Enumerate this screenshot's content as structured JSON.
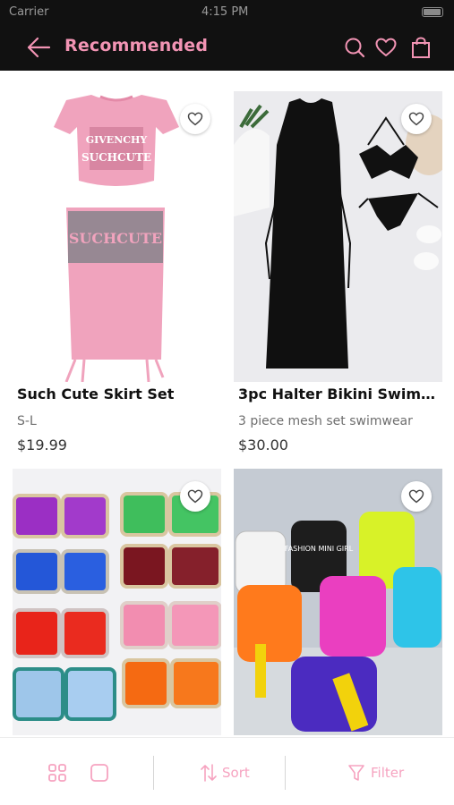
{
  "status": {
    "carrier": "Carrier",
    "time": "4:15 PM"
  },
  "header": {
    "title": "Recommended"
  },
  "products": [
    {
      "name": "Such Cute Skirt Set",
      "subtitle": "S-L",
      "price": "$19.99",
      "image_text_top": "GIVENCHY",
      "image_text_bottom": "SUCHCUTE"
    },
    {
      "name": "3pc Halter Bikini Swimsu...",
      "subtitle": "3 piece mesh set swimwear",
      "price": "$30.00"
    },
    {
      "name": "",
      "subtitle": "",
      "price": ""
    },
    {
      "name": "",
      "subtitle": "",
      "price": "",
      "image_text": "FASHION MINI GIRL"
    }
  ],
  "bottombar": {
    "sort_label": "Sort",
    "filter_label": "Filter"
  },
  "colors": {
    "accent": "#f294b4",
    "topbar": "#111111"
  }
}
